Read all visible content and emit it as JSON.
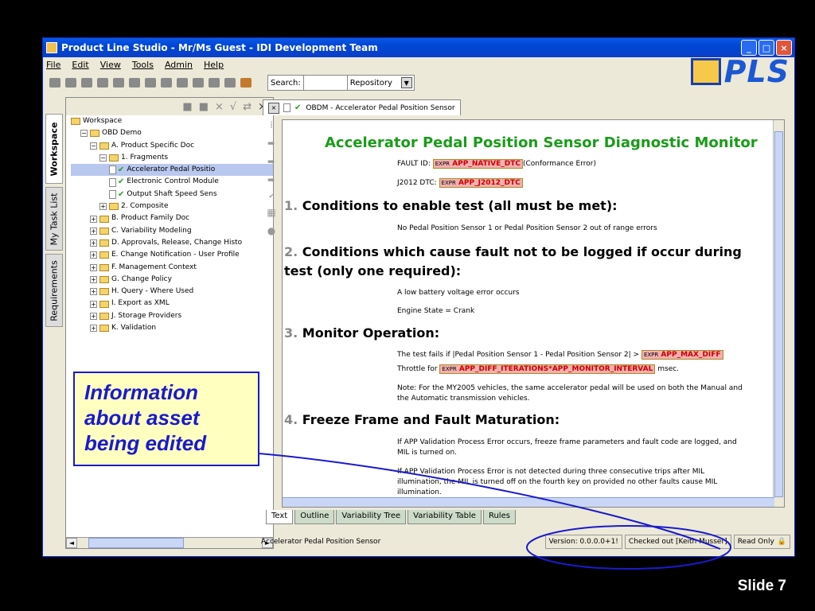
{
  "window": {
    "title": "Product Line Studio - Mr/Ms Guest - IDI Development Team"
  },
  "menu": [
    "File",
    "Edit",
    "View",
    "Tools",
    "Admin",
    "Help"
  ],
  "search": {
    "label": "Search:",
    "scope": "Repository"
  },
  "logo": "PLS",
  "vtabs": [
    "Workspace",
    "My Task List",
    "Requirements"
  ],
  "tree": [
    {
      "label": "Workspace",
      "level": 0,
      "type": "folder"
    },
    {
      "label": "OBD Demo",
      "level": 1,
      "type": "folder"
    },
    {
      "label": "A. Product Specific Doc",
      "level": 2,
      "type": "folder"
    },
    {
      "label": "1. Fragments",
      "level": 3,
      "type": "folder"
    },
    {
      "label": "Accelerator Pedal Positio",
      "level": 4,
      "type": "doc",
      "selected": true
    },
    {
      "label": "Electronic Control Module",
      "level": 4,
      "type": "doc"
    },
    {
      "label": "Output Shaft Speed Sens",
      "level": 4,
      "type": "doc"
    },
    {
      "label": "2. Composite",
      "level": 3,
      "type": "folder"
    },
    {
      "label": "B. Product Family Doc",
      "level": 2,
      "type": "folder"
    },
    {
      "label": "C. Variability Modeling",
      "level": 2,
      "type": "folder"
    },
    {
      "label": "D. Approvals, Release, Change Histo",
      "level": 2,
      "type": "folder"
    },
    {
      "label": "E. Change Notification - User Profile",
      "level": 2,
      "type": "folder"
    },
    {
      "label": "F. Management Context",
      "level": 2,
      "type": "folder"
    },
    {
      "label": "G. Change Policy",
      "level": 2,
      "type": "folder"
    },
    {
      "label": "H. Query - Where Used",
      "level": 2,
      "type": "folder"
    },
    {
      "label": "I. Export as XML",
      "level": 2,
      "type": "folder"
    },
    {
      "label": "J. Storage Providers",
      "level": 2,
      "type": "folder"
    },
    {
      "label": "K. Validation",
      "level": 2,
      "type": "folder"
    }
  ],
  "editor_tab": "OBDM - Accelerator Pedal Position Sensor",
  "doc": {
    "title": "Accelerator Pedal Position Sensor Diagnostic Monitor",
    "fault_id_label": "FAULT ID:",
    "fault_id_expr": "APP_NATIVE_DTC",
    "fault_id_suffix": "(Conformance Error)",
    "j2012_label": "J2012 DTC:",
    "j2012_expr": "APP_J2012_DTC",
    "expr_tag": "EXPR",
    "s1_num": "1.",
    "s1_title": "Conditions to enable test (all must be met):",
    "s1_text": "No Pedal Position Sensor 1 or Pedal Position Sensor 2 out of range errors",
    "s2_num": "2.",
    "s2_title_a": "Conditions which cause fault not to be logged if occur during",
    "s2_title_b": "test (only one required):",
    "s2_text1": "A low battery voltage error occurs",
    "s2_text2": "Engine State = Crank",
    "s3_num": "3.",
    "s3_title": "Monitor Operation:",
    "s3_text1": "The test fails if |Pedal Position Sensor 1 - Pedal Position Sensor 2| >",
    "s3_expr1": "APP_MAX_DIFF",
    "s3_text2": "Throttle for",
    "s3_expr2": "APP_DIFF_ITERATIONS*APP_MONITOR_INTERVAL",
    "s3_text3": "msec.",
    "s3_note1": "Note:  For the MY2005 vehicles, the same accelerator pedal will be used on both the Manual and",
    "s3_note2": "the Automatic transmission vehicles.",
    "s4_num": "4.",
    "s4_title": "Freeze Frame and Fault Maturation:",
    "s4_p1a": "If APP Validation Process Error occurs, freeze frame parameters and fault code are logged, and",
    "s4_p1b": "MIL is turned on.",
    "s4_p2a": "If APP Validation Process Error is not detected during three consecutive trips after MIL",
    "s4_p2b": "illumination, the MIL is turned off on the fourth key on provided no other faults cause MIL",
    "s4_p2c": "illumination."
  },
  "bottom_tabs": [
    "Text",
    "Outline",
    "Variability Tree",
    "Variability Table",
    "Rules"
  ],
  "status": {
    "asset": "Accelerator Pedal Position Sensor",
    "version": "Version: 0.0.0.0+1!",
    "checkout": "Checked out [Keith Musser]",
    "mode": "Read Only"
  },
  "callout": {
    "line1": "Information",
    "line2": "about asset",
    "line3": "being edited"
  },
  "slide": "Slide 7"
}
